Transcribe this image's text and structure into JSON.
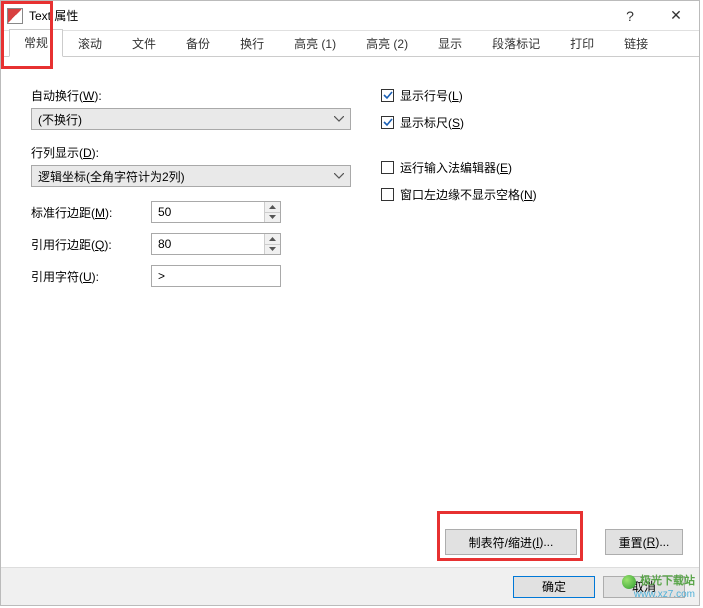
{
  "window": {
    "title": "Text 属性",
    "help": "?",
    "close": "✕"
  },
  "tabs": [
    {
      "label": "常规",
      "active": true
    },
    {
      "label": "滚动"
    },
    {
      "label": "文件"
    },
    {
      "label": "备份"
    },
    {
      "label": "换行"
    },
    {
      "label": "高亮 (1)"
    },
    {
      "label": "高亮 (2)"
    },
    {
      "label": "显示"
    },
    {
      "label": "段落标记"
    },
    {
      "label": "打印"
    },
    {
      "label": "链接"
    }
  ],
  "left": {
    "auto_wrap": {
      "label_pre": "自动换行(",
      "hotkey": "W",
      "label_post": "):",
      "value": "(不换行)"
    },
    "row_display": {
      "label_pre": "行列显示(",
      "hotkey": "D",
      "label_post": "):",
      "value": "逻辑坐标(全角字符计为2列)"
    },
    "std_margin": {
      "label_pre": "标准行边距(",
      "hotkey": "M",
      "label_post": "):",
      "value": "50"
    },
    "quote_margin": {
      "label_pre": "引用行边距(",
      "hotkey": "Q",
      "label_post": "):",
      "value": "80"
    },
    "quote_char": {
      "label_pre": "引用字符(",
      "hotkey": "U",
      "label_post": "):",
      "value": ">"
    }
  },
  "right": {
    "show_line_no": {
      "checked": true,
      "label_pre": "显示行号(",
      "hotkey": "L",
      "label_post": ")"
    },
    "show_ruler": {
      "checked": true,
      "label_pre": "显示标尺(",
      "hotkey": "S",
      "label_post": ")"
    },
    "run_ime": {
      "checked": false,
      "label_pre": "运行输入法编辑器(",
      "hotkey": "E",
      "label_post": ")"
    },
    "no_left_space": {
      "checked": false,
      "label_pre": "窗口左边缘不显示空格(",
      "hotkey": "N",
      "label_post": ")"
    }
  },
  "buttons": {
    "tab_indent_pre": "制表符/缩进(",
    "tab_indent_hotkey": "I",
    "tab_indent_post": ")...",
    "reset_pre": "重置(",
    "reset_hotkey": "R",
    "reset_post": ")...",
    "ok": "确定",
    "cancel": "取消"
  },
  "watermark": {
    "brand": "极光下载站",
    "url": "www.xz7.com"
  }
}
